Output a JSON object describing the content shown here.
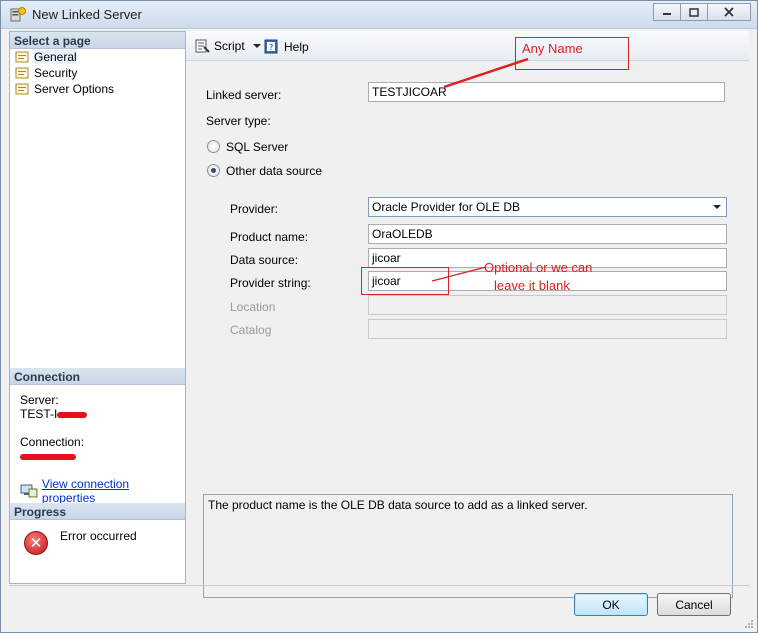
{
  "window": {
    "title": "New Linked Server"
  },
  "left": {
    "select_page_header": "Select a page",
    "pages": [
      {
        "label": "General"
      },
      {
        "label": "Security"
      },
      {
        "label": "Server Options"
      }
    ],
    "connection_header": "Connection",
    "server_label": "Server:",
    "server_value": "TEST-I",
    "connection_label": "Connection:",
    "view_connection_link": "View connection properties",
    "progress_header": "Progress",
    "progress_status": "Error occurred"
  },
  "toolbar": {
    "script_label": "Script",
    "help_label": "Help"
  },
  "form": {
    "linked_server_label": "Linked server:",
    "linked_server_value": "TESTJICOAR",
    "server_type_label": "Server type:",
    "sql_server_label": "SQL Server",
    "other_source_label": "Other data source",
    "selected_type": "Other data source",
    "provider_label": "Provider:",
    "provider_value": "Oracle Provider for OLE DB",
    "product_name_label": "Product name:",
    "product_name_value": "OraOLEDB",
    "data_source_label": "Data source:",
    "data_source_value": "jicoar",
    "provider_string_label": "Provider string:",
    "provider_string_value": "jicoar",
    "location_label": "Location",
    "location_value": "",
    "catalog_label": "Catalog",
    "catalog_value": ""
  },
  "description": "The product name is the OLE DB data source to add as a linked server.",
  "annotations": {
    "any_name": "Any Name",
    "optional_line1": "Optional or we can",
    "optional_line2": "leave it blank",
    "color": "#e02020"
  },
  "buttons": {
    "ok": "OK",
    "cancel": "Cancel"
  }
}
